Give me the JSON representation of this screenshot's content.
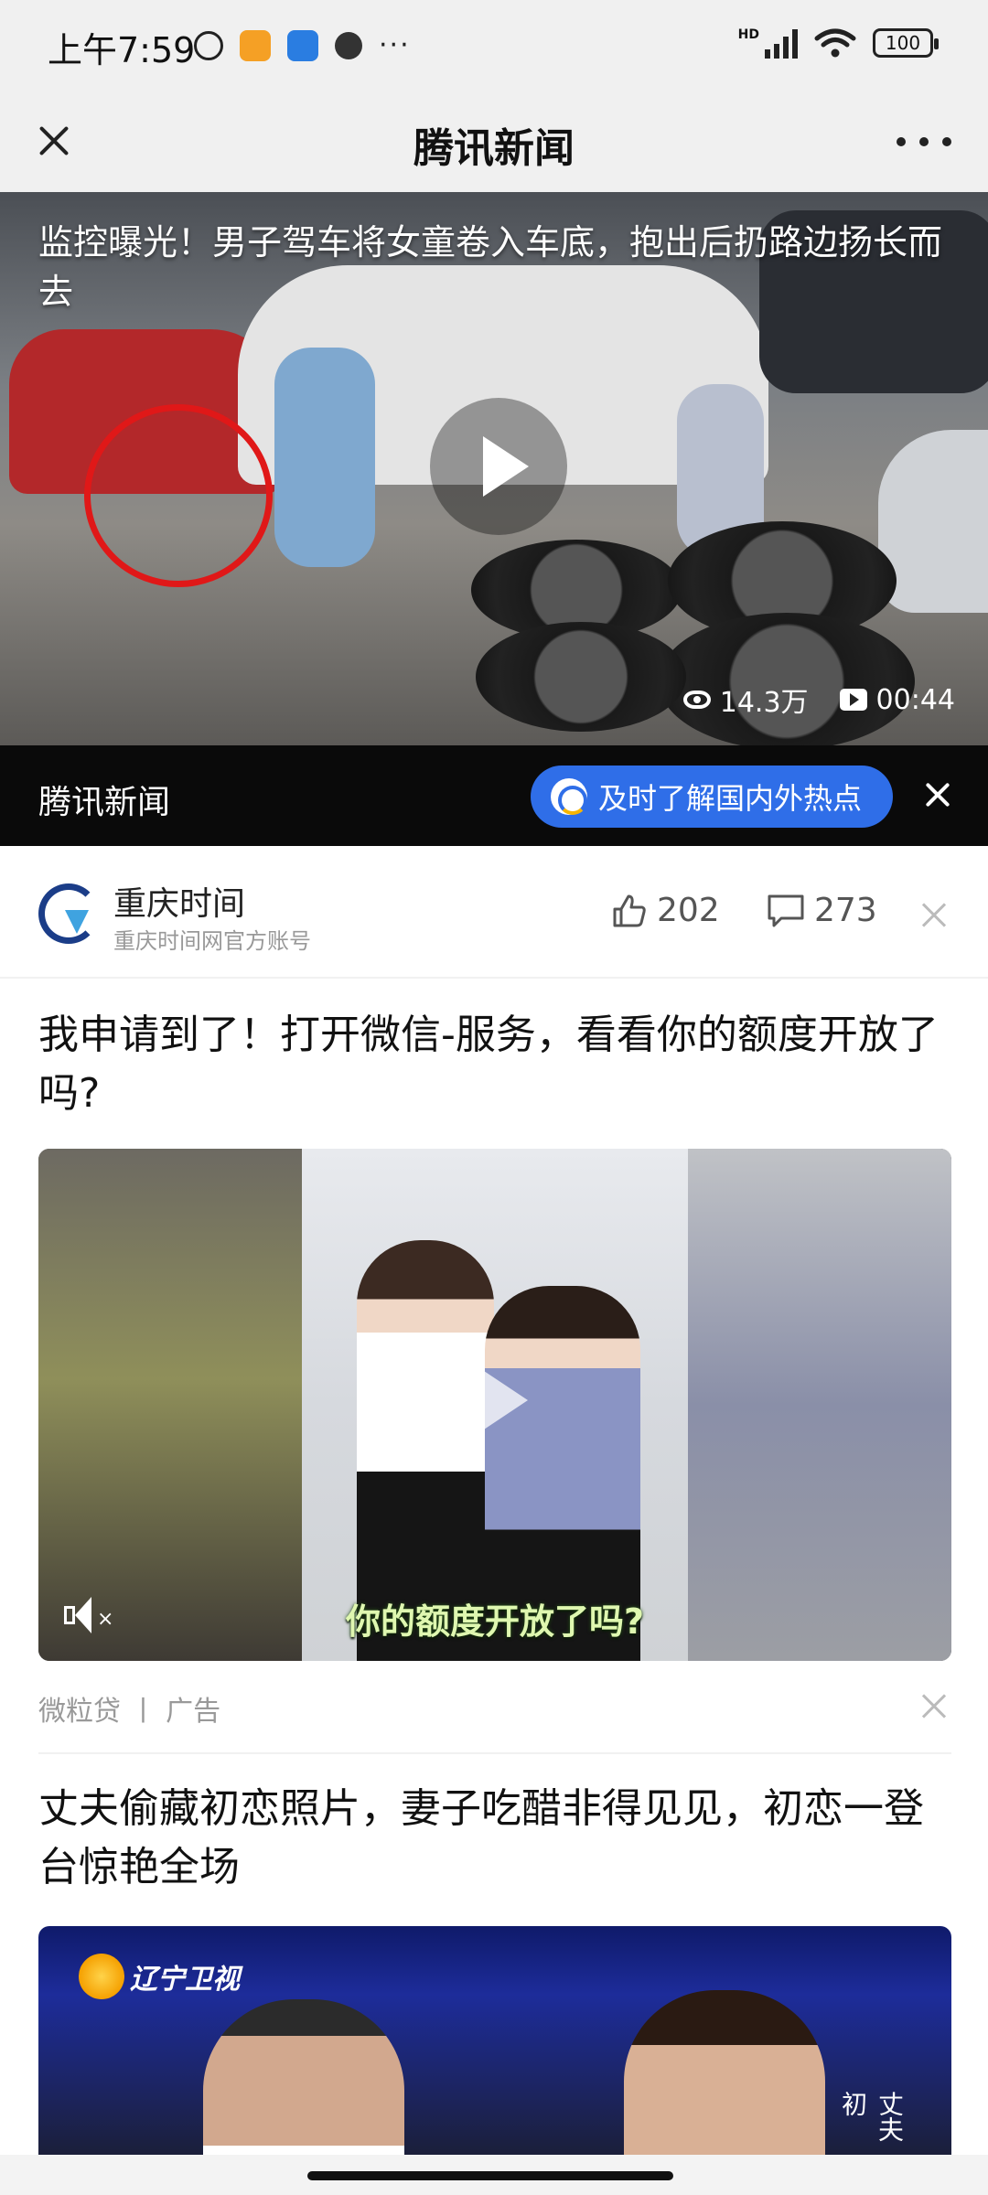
{
  "status_bar": {
    "time": "上午7:59",
    "network": "HD",
    "battery": "100",
    "more_dots": "···"
  },
  "top_bar": {
    "title": "腾讯新闻"
  },
  "hero": {
    "title": "监控曝光！男子驾车将女童卷入车底，抱出后扔路边扬长而去",
    "views": "14.3万",
    "duration": "00:44",
    "source_label": "腾讯新闻",
    "cta_label": "及时了解国内外热点"
  },
  "author": {
    "name": "重庆时间",
    "subtitle": "重庆时间网官方账号",
    "likes": "202",
    "comments": "273"
  },
  "article_ad": {
    "title": "我申请到了！打开微信-服务，看看你的额度开放了吗?",
    "caption": "你的额度开放了吗?",
    "source": "微粒贷",
    "separator": "丨",
    "tag": "广告"
  },
  "article_2": {
    "title": "丈夫偷藏初恋照片，妻子吃醋非得见见，初恋一登台惊艳全场",
    "tv_logo": "辽宁卫视",
    "side_text": "丈夫初"
  },
  "colors": {
    "accent_blue": "#2f6ee8",
    "caption_green": "#dff7b0",
    "highlight_red": "#e01818"
  }
}
